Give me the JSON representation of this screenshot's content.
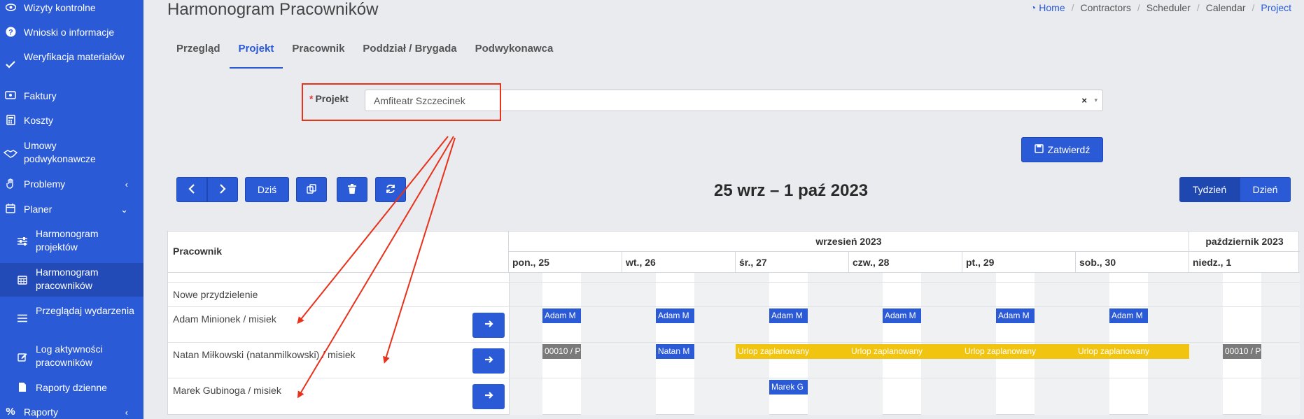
{
  "sidebar": {
    "items": [
      {
        "label": "Wizyty kontrolne",
        "icon": "eye-icon"
      },
      {
        "label": "Wnioski o informacje",
        "icon": "question-icon"
      },
      {
        "label": "Weryfikacja materiałów",
        "icon": "check-icon"
      },
      {
        "label": "Faktury",
        "icon": "money-icon"
      },
      {
        "label": "Koszty",
        "icon": "calculator-icon"
      },
      {
        "label": "Umowy podwykonawcze",
        "icon": "handshake-icon"
      },
      {
        "label": "Problemy",
        "icon": "hand-icon"
      },
      {
        "label": "Planer",
        "icon": "calendar-icon"
      },
      {
        "label": "Harmonogram projektów",
        "icon": "sliders-icon"
      },
      {
        "label": "Harmonogram pracowników",
        "icon": "calendar-grid-icon"
      },
      {
        "label": "Przeglądaj wydarzenia",
        "icon": "list-icon"
      },
      {
        "label": "Log aktywności pracowników",
        "icon": "edit-icon"
      },
      {
        "label": "Raporty dzienne",
        "icon": "document-icon"
      },
      {
        "label": "Raporty",
        "icon": "percent-icon"
      }
    ]
  },
  "header": {
    "title": "Harmonogram Pracowników",
    "breadcrumb": [
      "Home",
      "Contractors",
      "Scheduler",
      "Calendar",
      "Project"
    ]
  },
  "tabs": [
    "Przegląd",
    "Projekt",
    "Pracownik",
    "Poddział / Brygada",
    "Podwykonawca"
  ],
  "active_tab": "Projekt",
  "project_field": {
    "required_mark": "*",
    "label": "Projekt",
    "value": "Amfiteatr Szczecinek",
    "clear": "×",
    "arrow": "▾"
  },
  "confirm_button": "Zatwierdź",
  "toolbar": {
    "today": "Dziś"
  },
  "calendar": {
    "title": "25 wrz – 1 paź 2023",
    "view_week": "Tydzień",
    "view_day": "Dzień",
    "resource_header": "Pracownik",
    "months": [
      "wrzesień 2023",
      "październik 2023"
    ],
    "days": [
      "pon., 25",
      "wt., 26",
      "śr., 27",
      "czw., 28",
      "pt., 29",
      "sob., 30",
      "niedz., 1"
    ],
    "rows": [
      {
        "label": "Nowe przydzielenie",
        "has_button": false
      },
      {
        "label": "Adam Minionek / misiek",
        "has_button": true
      },
      {
        "label": "Natan Miłkowski (natanmilkowski) / misiek",
        "has_button": true
      },
      {
        "label": "Marek Gubinoga / misiek",
        "has_button": true
      }
    ],
    "events": [
      {
        "row": 1,
        "day": 0,
        "text": "Adam M",
        "color": "blue"
      },
      {
        "row": 1,
        "day": 1,
        "text": "Adam M",
        "color": "blue"
      },
      {
        "row": 1,
        "day": 2,
        "text": "Adam M",
        "color": "blue"
      },
      {
        "row": 1,
        "day": 3,
        "text": "Adam M",
        "color": "blue"
      },
      {
        "row": 1,
        "day": 4,
        "text": "Adam M",
        "color": "blue"
      },
      {
        "row": 1,
        "day": 5,
        "text": "Adam M",
        "color": "blue"
      },
      {
        "row": 2,
        "day": 0,
        "text": "00010 / P",
        "color": "gray"
      },
      {
        "row": 2,
        "day": 1,
        "text": "Natan M",
        "color": "blue"
      },
      {
        "row": 2,
        "day": 2,
        "text": "Urlop zaplanowany",
        "color": "yellow"
      },
      {
        "row": 2,
        "day": 3,
        "text": "Urlop zaplanowany",
        "color": "yellow"
      },
      {
        "row": 2,
        "day": 4,
        "text": "Urlop zaplanowany",
        "color": "yellow"
      },
      {
        "row": 2,
        "day": 5,
        "text": "Urlop zaplanowany",
        "color": "yellow"
      },
      {
        "row": 2,
        "day": 6,
        "text": "00010 / P",
        "color": "gray"
      },
      {
        "row": 3,
        "day": 2,
        "text": "Marek G",
        "color": "blue"
      }
    ]
  },
  "colors": {
    "primary": "#2b5ad6",
    "annotation": "#e8321c",
    "vacation": "#f1c40f",
    "gray_event": "#7a7a7a"
  }
}
